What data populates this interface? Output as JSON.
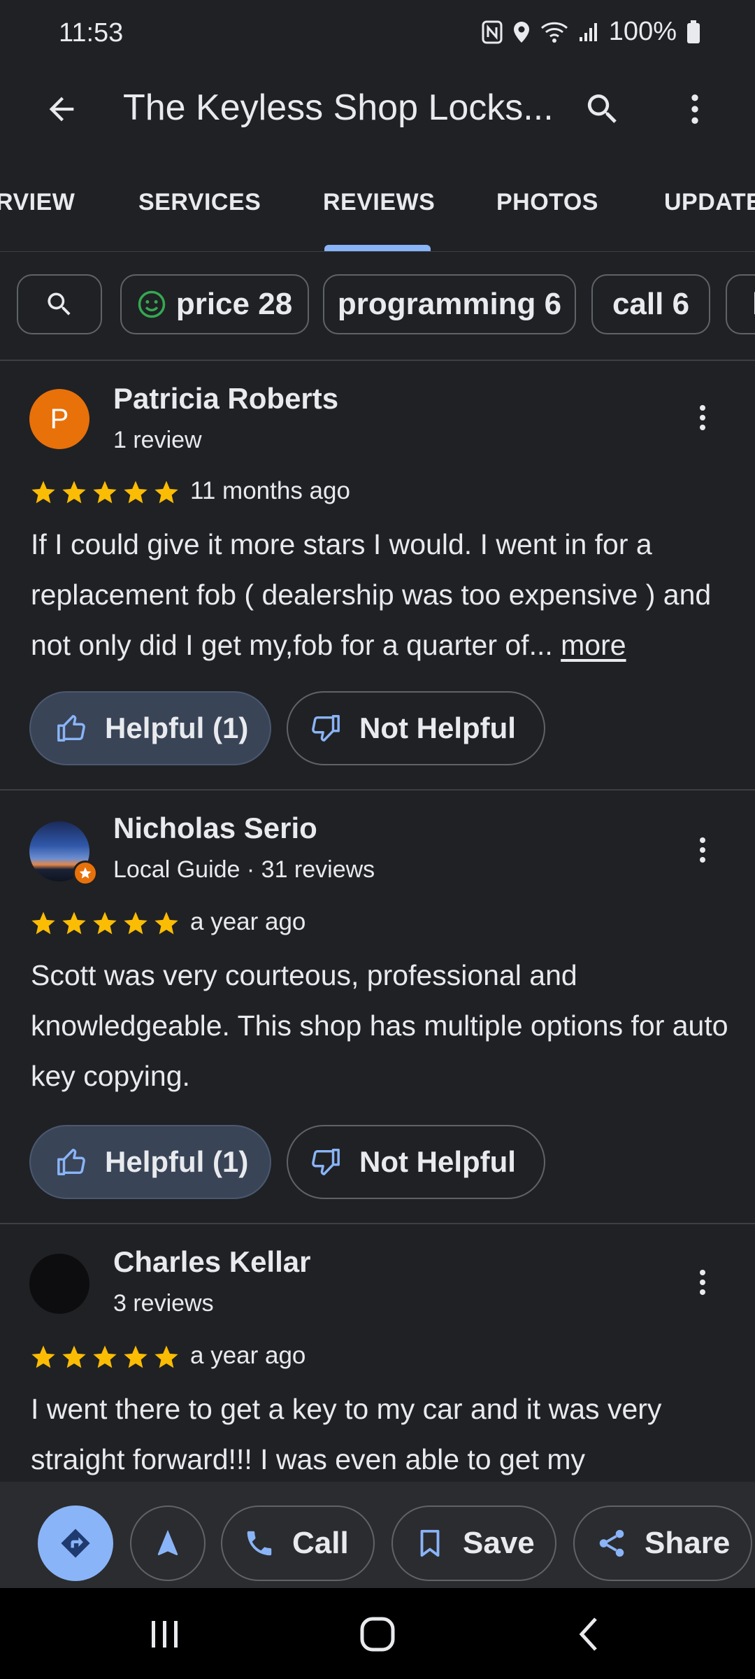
{
  "status_bar": {
    "time": "11:53",
    "battery": "100%",
    "icons": [
      "nfc-icon",
      "location-icon",
      "wifi-icon",
      "signal-icon",
      "battery-icon"
    ]
  },
  "app_bar": {
    "title": "The Keyless Shop Locks...",
    "icons": [
      "back-arrow-icon",
      "search-icon",
      "more-vert-icon"
    ]
  },
  "tabs": [
    {
      "label": "RVIEW",
      "active": false
    },
    {
      "label": "SERVICES",
      "active": false
    },
    {
      "label": "REVIEWS",
      "active": true
    },
    {
      "label": "PHOTOS",
      "active": false
    },
    {
      "label": "UPDATE",
      "active": false
    }
  ],
  "chips": [
    {
      "label": "",
      "icon": "search-icon"
    },
    {
      "label": "price 28",
      "icon": "smiley-icon"
    },
    {
      "label": "programming 6"
    },
    {
      "label": "call 6"
    },
    {
      "label": "k"
    }
  ],
  "reviews": [
    {
      "name": "Patricia Roberts",
      "meta": "1 review",
      "avatar_letter": "P",
      "avatar_color": "#e8710a",
      "rating": 5,
      "date": "11 months ago",
      "text": "If I could give it more stars I would. I went in for a replacement fob ( dealership was too expensive ) and not only did I get my,fob for a quarter of...",
      "more_label": "more",
      "helpful_label": "Helpful (1)",
      "not_helpful_label": "Not Helpful"
    },
    {
      "name": "Nicholas Serio",
      "meta": "Local Guide · 31 reviews",
      "rating": 5,
      "date": "a year ago",
      "text": "Scott was very courteous, professional and knowledgeable. This shop has multiple options for auto key copying.",
      "helpful_label": "Helpful (1)",
      "not_helpful_label": "Not Helpful"
    },
    {
      "name": "Charles Kellar",
      "meta": "3 reviews",
      "rating": 5,
      "date": "a year ago",
      "text": "I went there to get a key to my car and it was very straight forward!!! I was even able to get my"
    }
  ],
  "bottom_bar": {
    "call_label": "Call",
    "save_label": "Save",
    "share_label": "Share",
    "icons": [
      "directions-icon",
      "navigation-arrow-icon",
      "phone-icon",
      "bookmark-icon",
      "share-icon"
    ]
  },
  "colors": {
    "background": "#202124",
    "accent": "#8ab4f8",
    "star": "#fbbc04",
    "text": "#e8eaed",
    "divider": "#3c4043"
  }
}
